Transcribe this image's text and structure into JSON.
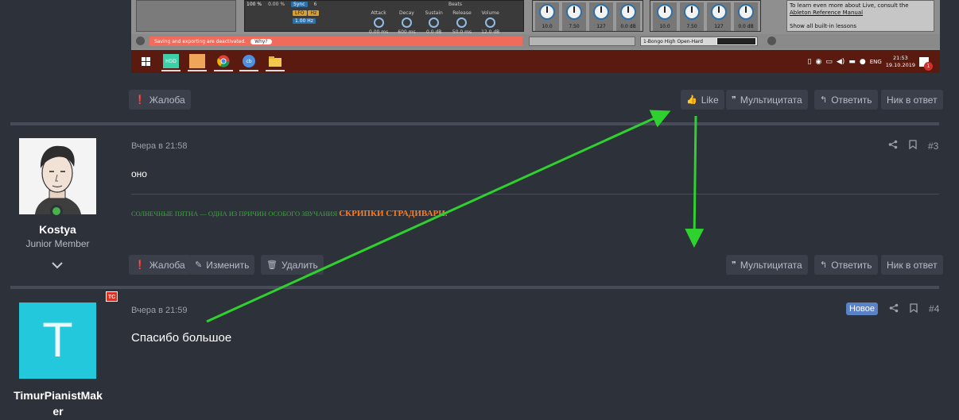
{
  "embed": {
    "device": {
      "pct1": "100 %",
      "pct2": "0.00 %",
      "chip1": "Sync",
      "num": "6",
      "lfo": "LFO",
      "hz": "Hz",
      "rate": "1.00 Hz",
      "beats": "Beats",
      "env": [
        {
          "label": "Attack",
          "value": "0.00 ms"
        },
        {
          "label": "Decay",
          "value": "600 ms"
        },
        {
          "label": "Sustain",
          "value": "0.0 dB"
        },
        {
          "label": "Release",
          "value": "50.0 ms"
        },
        {
          "label": "Volume",
          "value": "12.0 dB"
        }
      ]
    },
    "knobs1": [
      "10.0",
      "7.50",
      "127",
      "0.0 dB"
    ],
    "knobs2": [
      "10.0",
      "7.50",
      "127",
      "0.0 dB"
    ],
    "help": {
      "line1": "To learn even more about Live, consult the",
      "link": "Ableton Reference Manual",
      "line3": "Show all built-in lessons"
    },
    "status": {
      "message": "Saving and exporting are deactivated.",
      "why": "Why?",
      "track": "1-Bongo High Open-Hard"
    },
    "taskbar": {
      "apps": [
        "HDD",
        "",
        "",
        "cb",
        ""
      ],
      "lang": "ENG",
      "time": "21:53",
      "date": "19.10.2019",
      "notif_count": "1"
    }
  },
  "post_prev_actions": {
    "report": "Жалоба",
    "like": "Like",
    "multiquote": "Мультицитата",
    "reply": "Ответить",
    "nick_reply": "Ник в ответ"
  },
  "post3": {
    "user": {
      "name": "Kostya",
      "title": "Junior Member"
    },
    "time": "Вчера в 21:58",
    "number": "#3",
    "text": "оно",
    "signature": {
      "part1": "СОЛНЕЧНЫЕ ПЯТНА — ОДНА ИЗ ПРИЧИН ОСОБОГО ЗВУЧАНИЯ",
      "part2": "СКРИПКИ СТРАДИВАРИ."
    },
    "actions": {
      "report": "Жалоба",
      "edit": "Изменить",
      "delete": "Удалить",
      "multiquote": "Мультицитата",
      "reply": "Ответить",
      "nick_reply": "Ник в ответ"
    }
  },
  "post4": {
    "user": {
      "name_line1": "TimurPianistMak",
      "name_line2": "er",
      "initial": "T",
      "badge": "TC"
    },
    "time": "Вчера в 21:59",
    "new_label": "Новое",
    "number": "#4",
    "text": "Спасибо большое"
  },
  "colors": {
    "background": "#2d313a",
    "button": "#3a3f4a",
    "arrow": "#2fd12f",
    "online": "#48b34a",
    "avatar_teal": "#23c8dd",
    "new_badge": "#5a82c6"
  }
}
